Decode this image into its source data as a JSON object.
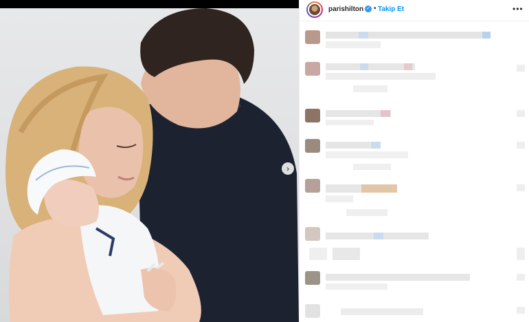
{
  "post": {
    "username": "parishilton",
    "verified": true,
    "separator": "•",
    "follow_label": "Takip Et",
    "more_label": "•••",
    "next_icon": "›"
  },
  "colors": {
    "accent": "#0095f6",
    "verified": "#3897f0",
    "text": "#262626"
  }
}
